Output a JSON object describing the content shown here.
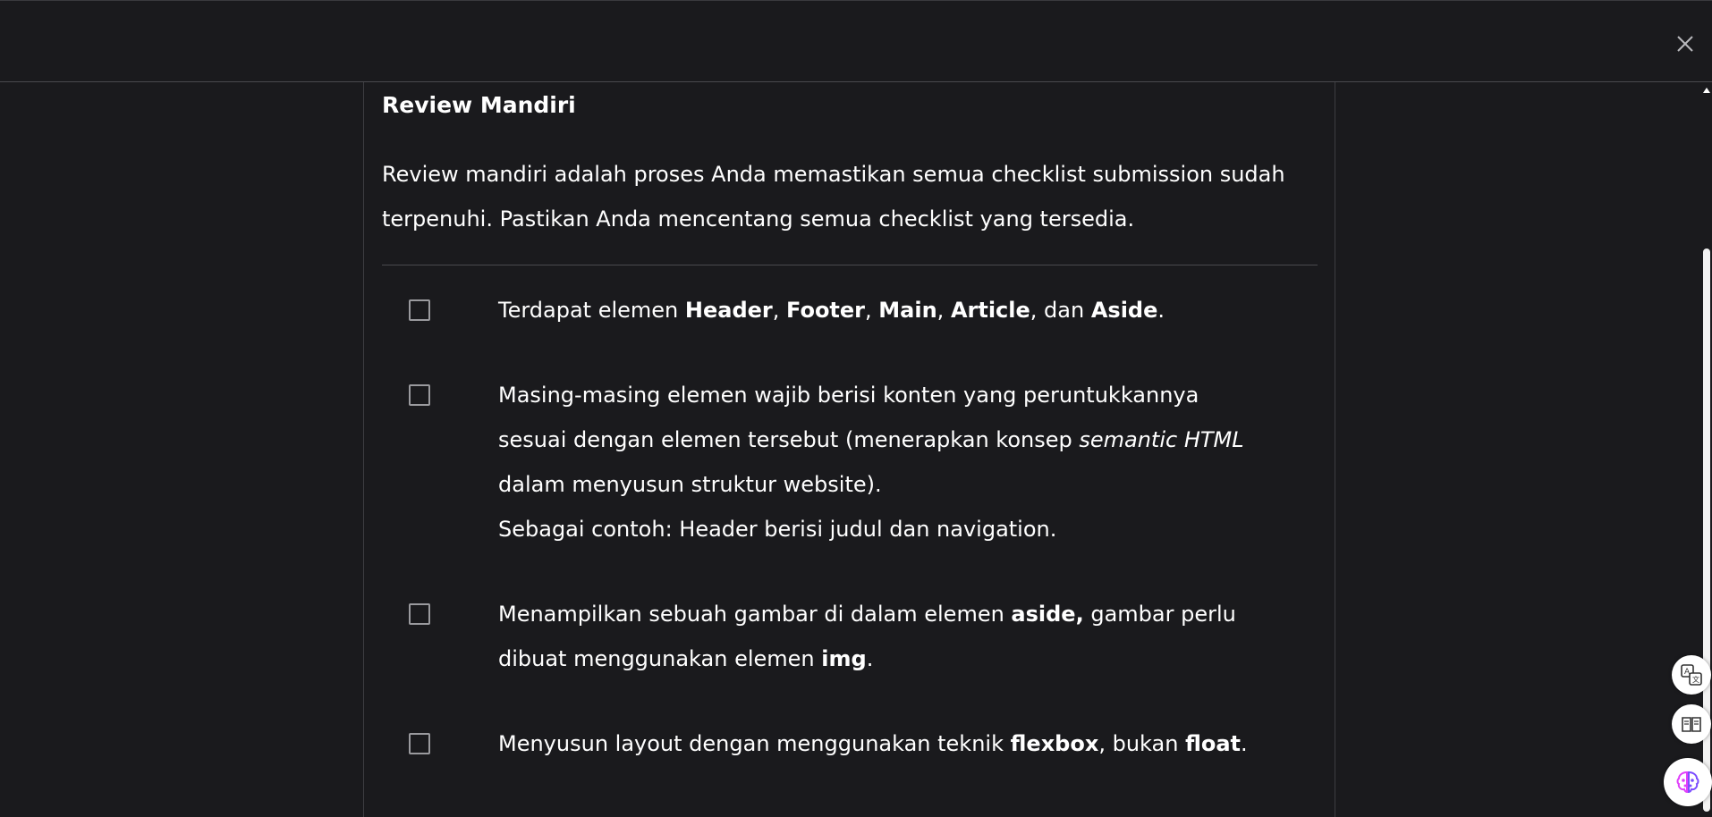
{
  "modal": {
    "close_icon": "close-icon"
  },
  "review": {
    "title": "Review Mandiri",
    "intro": "Review mandiri adalah proses Anda memastikan semua checklist submission sudah terpenuhi. Pastikan Anda mencentang semua checklist yang tersedia.",
    "items": [
      {
        "checked": false,
        "parts": [
          {
            "t": "Terdapat elemen ",
            "s": ""
          },
          {
            "t": "Header",
            "s": "b"
          },
          {
            "t": ", ",
            "s": ""
          },
          {
            "t": "Footer",
            "s": "b"
          },
          {
            "t": ", ",
            "s": ""
          },
          {
            "t": "Main",
            "s": "b"
          },
          {
            "t": ", ",
            "s": ""
          },
          {
            "t": "Article",
            "s": "b"
          },
          {
            "t": ", dan ",
            "s": ""
          },
          {
            "t": "Aside",
            "s": "b"
          },
          {
            "t": ".",
            "s": ""
          }
        ]
      },
      {
        "checked": false,
        "parts": [
          {
            "t": "Masing-masing elemen wajib berisi konten yang peruntukkannya sesuai dengan elemen tersebut (menerapkan konsep ",
            "s": ""
          },
          {
            "t": "semantic HTML",
            "s": "i"
          },
          {
            "t": " dalam menyusun struktur website).",
            "s": ""
          },
          {
            "t": "",
            "s": "br"
          },
          {
            "t": "Sebagai contoh: Header berisi judul dan navigation.",
            "s": ""
          }
        ]
      },
      {
        "checked": false,
        "parts": [
          {
            "t": "Menampilkan sebuah gambar di dalam elemen ",
            "s": ""
          },
          {
            "t": "aside,",
            "s": "b"
          },
          {
            "t": " gambar perlu dibuat menggunakan elemen ",
            "s": ""
          },
          {
            "t": "img",
            "s": "b"
          },
          {
            "t": ".",
            "s": ""
          }
        ]
      },
      {
        "checked": false,
        "parts": [
          {
            "t": "Menyusun layout dengan menggunakan teknik ",
            "s": ""
          },
          {
            "t": "flexbox",
            "s": "b"
          },
          {
            "t": ", bukan ",
            "s": ""
          },
          {
            "t": "float",
            "s": "b"
          },
          {
            "t": ".",
            "s": ""
          }
        ]
      }
    ]
  },
  "floating_buttons": [
    {
      "icon": "translate-icon"
    },
    {
      "icon": "reader-mode-icon"
    },
    {
      "icon": "ai-brain-icon",
      "color": "#e040fb"
    }
  ]
}
